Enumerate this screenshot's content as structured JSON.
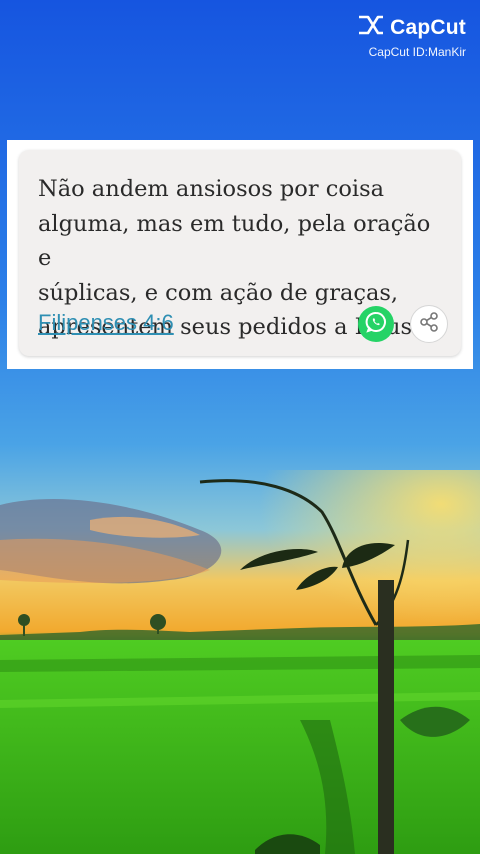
{
  "watermark": {
    "logo_text": "CapCut",
    "id_text": "CapCut ID:ManKir",
    "icon": "capcut-logo-icon"
  },
  "verse_card": {
    "verse_lines": [
      "Não andem ansiosos por coisa",
      "alguma, mas em tudo, pela oração e",
      "súplicas, e com ação de graças,",
      "apresentem seus pedidos a Deus."
    ],
    "reference": "Filipenses 4:6",
    "whatsapp_icon": "whatsapp-icon",
    "share_icon": "share-icon"
  },
  "colors": {
    "sky_top": "#1a5fe0",
    "sunset": "#f5b23a",
    "field": "#3fbf1f",
    "link": "#2f8fb3",
    "whatsapp": "#25d366"
  }
}
